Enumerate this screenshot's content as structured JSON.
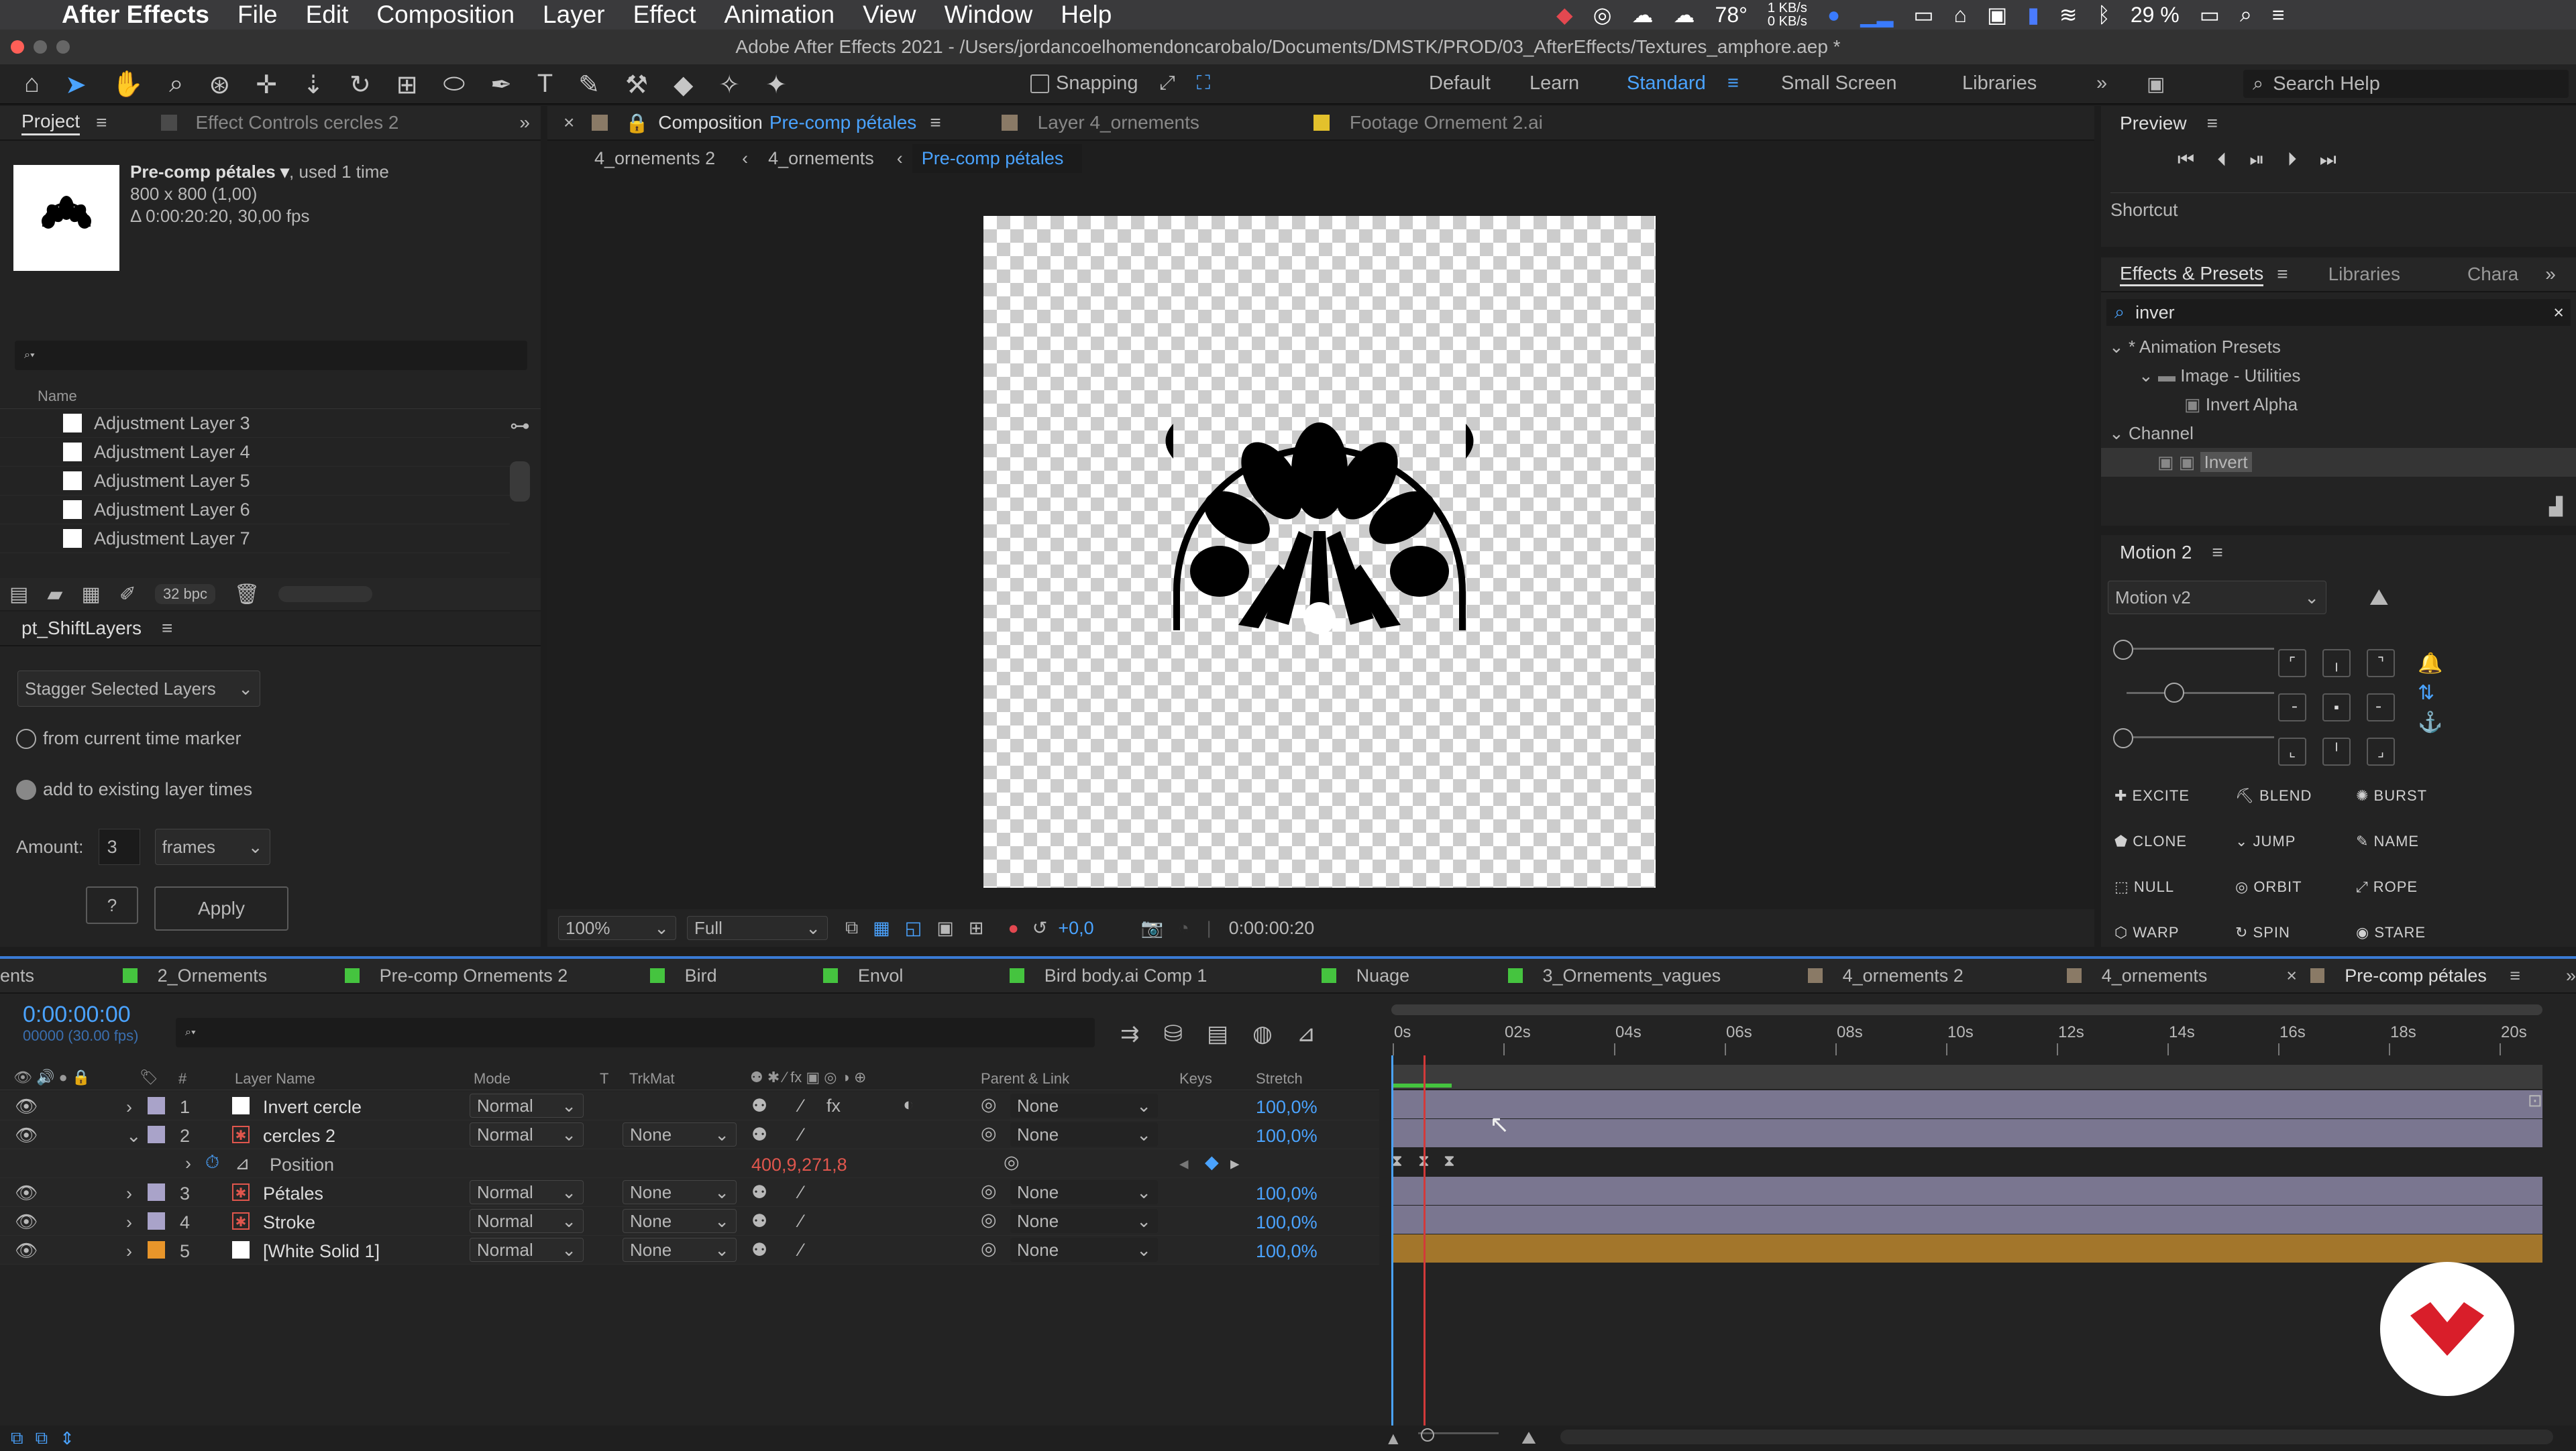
{
  "menubar": {
    "apple": "",
    "app": "After Effects",
    "items": [
      "File",
      "Edit",
      "Composition",
      "Layer",
      "Effect",
      "Animation",
      "View",
      "Window",
      "Help"
    ],
    "status": {
      "temp": "78°",
      "net_up": "1 KB/s",
      "net_down": "0 KB/s",
      "battery": "29 %"
    }
  },
  "window": {
    "title": "Adobe After Effects 2021 - /Users/jordancoelhomendoncarobalo/Documents/DMSTK/PROD/03_AfterEffects/Textures_amphore.aep *"
  },
  "toolbar": {
    "snapping": "Snapping",
    "workspaces": [
      "Default",
      "Learn",
      "Standard",
      "Small Screen",
      "Libraries"
    ],
    "active_workspace": "Standard",
    "search": "Search Help"
  },
  "project": {
    "tab": "Project",
    "tab2": "Effect Controls cercles 2",
    "item_name": "Pre-comp pétales ▾",
    "item_used": ", used 1 time",
    "item_size": "800 x 800 (1,00)",
    "item_dur": "Δ 0:00:20:20, 30,00 fps",
    "col_name": "Name",
    "items": [
      "Adjustment Layer 3",
      "Adjustment Layer 4",
      "Adjustment Layer 5",
      "Adjustment Layer 6",
      "Adjustment Layer 7"
    ],
    "bpc": "32 bpc"
  },
  "shiftlayers": {
    "title": "pt_ShiftLayers",
    "mode": "Stagger Selected Layers",
    "opt1": "from current time marker",
    "opt2": "add to existing layer times",
    "amount_label": "Amount:",
    "amount": "3",
    "unit": "frames",
    "help": "?",
    "apply": "Apply"
  },
  "viewer": {
    "tabs": [
      "Composition",
      "Pre-comp pétales",
      "Layer 4_ornements",
      "Footage Ornement 2.ai"
    ],
    "breadcrumbs": [
      "4_ornements 2",
      "4_ornements",
      "Pre-comp pétales"
    ],
    "zoom": "100%",
    "quality": "Full",
    "exposure": "+0,0",
    "time": "0:00:00:20"
  },
  "preview": {
    "title": "Preview",
    "shortcut": "Shortcut"
  },
  "effects": {
    "tab": "Effects & Presets",
    "tab2": "Libraries",
    "tab3": "Chara",
    "search": "inver",
    "tree": [
      "* Animation Presets",
      "Image - Utilities",
      "Invert Alpha",
      "Channel",
      "Invert"
    ]
  },
  "motion": {
    "title": "Motion 2",
    "version": "Motion v2",
    "buttons": [
      "EXCITE",
      "BLEND",
      "BURST",
      "CLONE",
      "JUMP",
      "NAME",
      "NULL",
      "ORBIT",
      "ROPE",
      "WARP",
      "SPIN",
      "STARE"
    ]
  },
  "timeline": {
    "tabs": [
      "ents",
      "2_Ornements",
      "Pre-comp Ornements 2",
      "Bird",
      "Envol",
      "Bird body.ai Comp 1",
      "Nuage",
      "3_Ornements_vagues",
      "4_ornements 2",
      "4_ornements",
      "Pre-comp pétales"
    ],
    "timecode": "0:00:00:00",
    "frame": "00000 (30.00 fps)",
    "headers": {
      "label": "#",
      "name": "Layer Name",
      "mode": "Mode",
      "t": "T",
      "trk": "TrkMat",
      "parent": "Parent & Link",
      "keys": "Keys",
      "stretch": "Stretch"
    },
    "ruler": [
      "0s",
      "02s",
      "04s",
      "06s",
      "08s",
      "10s",
      "12s",
      "14s",
      "16s",
      "18s",
      "20s"
    ],
    "layers": [
      {
        "num": "1",
        "name": "Invert cercle",
        "mode": "Normal",
        "trk": "",
        "parent": "None",
        "stretch": "100,0%",
        "color": "#a9a3c9"
      },
      {
        "num": "2",
        "name": "cercles 2",
        "mode": "Normal",
        "trk": "None",
        "parent": "None",
        "stretch": "100,0%",
        "color": "#a9a3c9"
      },
      {
        "num": "3",
        "name": "Pétales",
        "mode": "Normal",
        "trk": "None",
        "parent": "None",
        "stretch": "100,0%",
        "color": "#a9a3c9"
      },
      {
        "num": "4",
        "name": "Stroke",
        "mode": "Normal",
        "trk": "None",
        "parent": "None",
        "stretch": "100,0%",
        "color": "#a9a3c9"
      },
      {
        "num": "5",
        "name": "[White Solid 1]",
        "mode": "Normal",
        "trk": "None",
        "parent": "None",
        "stretch": "100,0%",
        "color": "#e8952a"
      }
    ],
    "position_label": "Position",
    "position_value": "400,9,271,8"
  },
  "colors": {
    "accent": "#4aa3ff",
    "layer_bar": "#7a7690",
    "solid_bar": "#a3762b",
    "playhead": "#d23a3a",
    "green": "#45c43f"
  }
}
